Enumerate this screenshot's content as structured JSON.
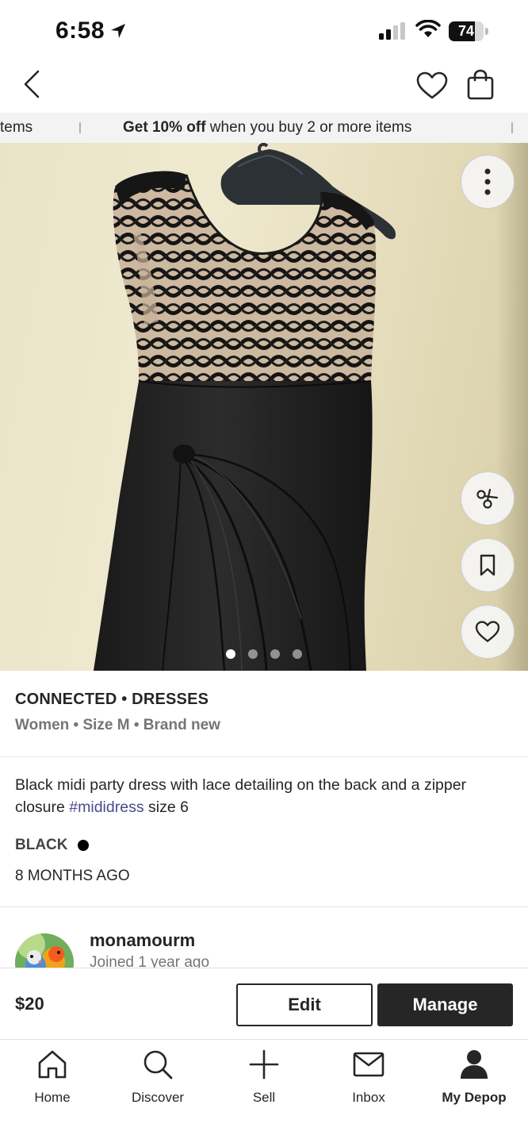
{
  "status_bar": {
    "time": "6:58",
    "battery": "74",
    "battery_level": 0.74
  },
  "promo": {
    "left_fragment": "tems",
    "separator": "|",
    "highlight": "Get 10% off",
    "rest": " when you buy 2 or more items"
  },
  "gallery": {
    "image_count": 4,
    "active_index": 0
  },
  "product": {
    "brand_category": "CONNECTED • DRESSES",
    "attributes": "Women • Size M • Brand new",
    "description_before": "Black midi party dress with lace detailing on the back and a zipper closure ",
    "hashtag": "#mididress",
    "description_after": " size 6",
    "color_label": "BLACK",
    "color_hex": "#000000",
    "posted": "8 MONTHS AGO"
  },
  "seller": {
    "username": "monamourm",
    "joined": "Joined 1 year ago"
  },
  "purchase": {
    "price": "$20",
    "edit_label": "Edit",
    "manage_label": "Manage"
  },
  "tabs": [
    {
      "label": "Home",
      "icon": "home-icon"
    },
    {
      "label": "Discover",
      "icon": "search-icon"
    },
    {
      "label": "Sell",
      "icon": "plus-icon"
    },
    {
      "label": "Inbox",
      "icon": "mail-icon"
    },
    {
      "label": "My Depop",
      "icon": "profile-icon",
      "active": true
    }
  ]
}
